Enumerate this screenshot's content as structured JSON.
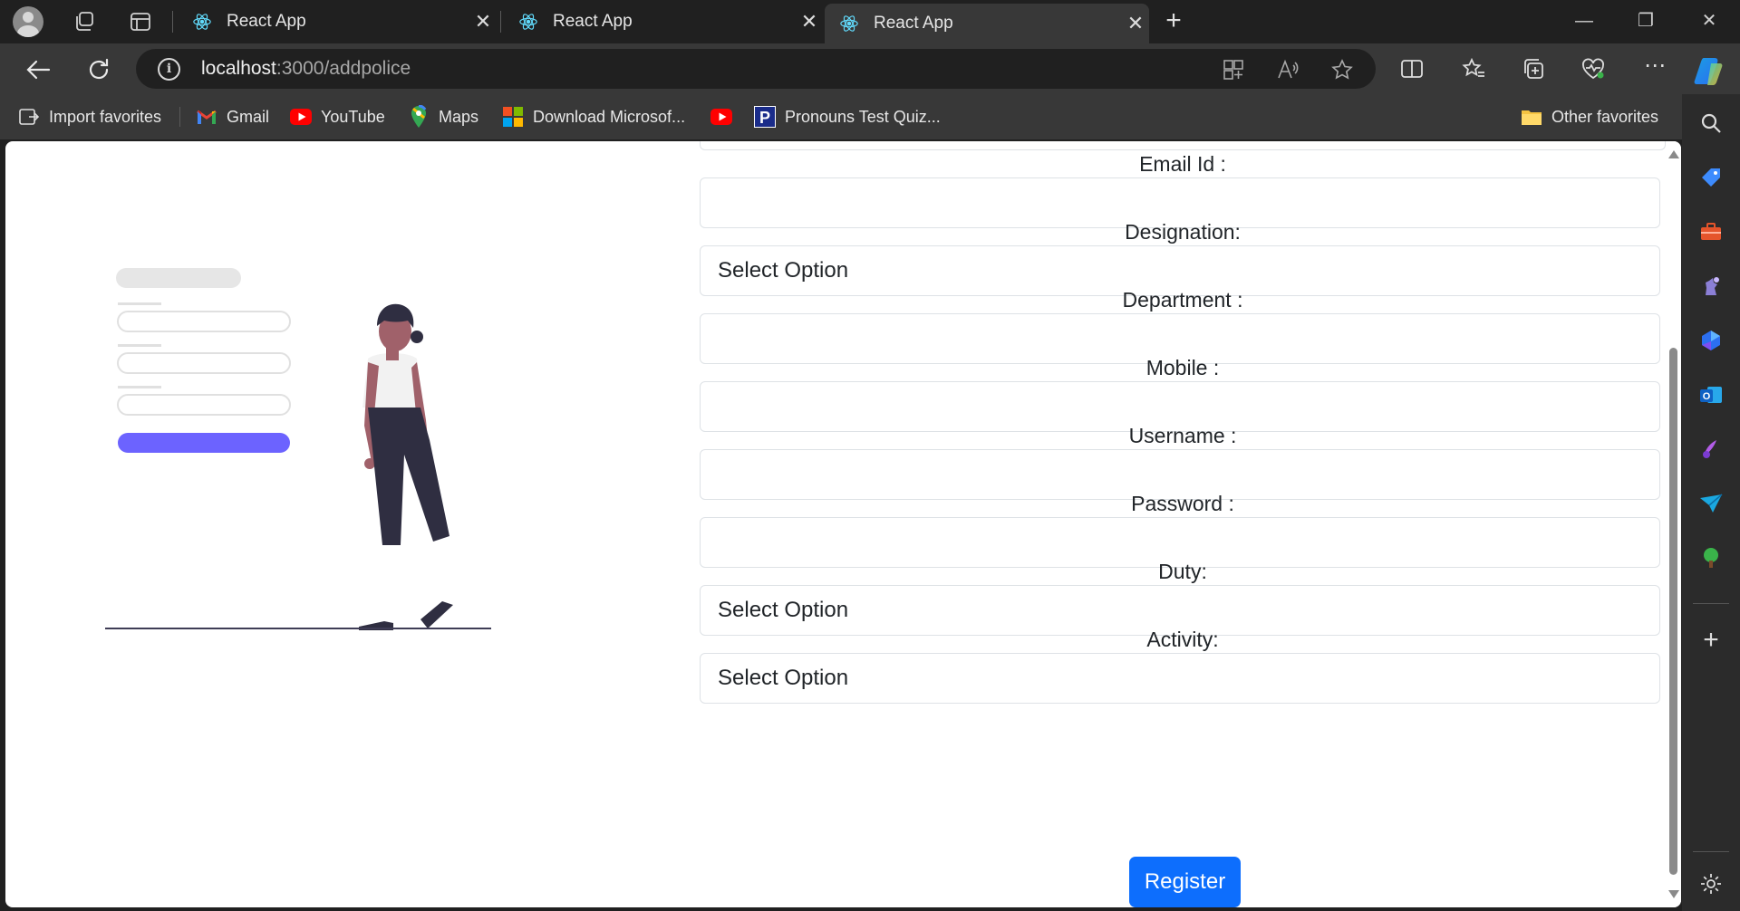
{
  "browser": {
    "tabs": [
      {
        "title": "React App",
        "active": false
      },
      {
        "title": "React App",
        "active": false
      },
      {
        "title": "React App",
        "active": true
      }
    ],
    "address": {
      "host": "localhost",
      "path": ":3000/addpolice"
    },
    "favorites": [
      {
        "label": "Import favorites",
        "icon": "import-icon"
      },
      {
        "label": "Gmail",
        "icon": "gmail-icon"
      },
      {
        "label": "YouTube",
        "icon": "youtube-icon"
      },
      {
        "label": "Maps",
        "icon": "maps-icon"
      },
      {
        "label": "Download Microsof...",
        "icon": "microsoft-icon"
      },
      {
        "label": "",
        "icon": "youtube-icon"
      },
      {
        "label": "Pronouns Test Quiz...",
        "icon": "pronouns-icon"
      }
    ],
    "other_favorites": "Other favorites"
  },
  "form": {
    "fields": [
      {
        "label": "Email Id :",
        "type": "input",
        "value": ""
      },
      {
        "label": "Designation:",
        "type": "select",
        "value": "Select Option"
      },
      {
        "label": "Department :",
        "type": "input",
        "value": ""
      },
      {
        "label": "Mobile :",
        "type": "input",
        "value": ""
      },
      {
        "label": "Username :",
        "type": "input",
        "value": ""
      },
      {
        "label": "Password :",
        "type": "input",
        "value": ""
      },
      {
        "label": "Duty:",
        "type": "select",
        "value": "Select Option"
      },
      {
        "label": "Activity:",
        "type": "select",
        "value": "Select Option"
      }
    ],
    "submit_label": "Register"
  },
  "colors": {
    "accent": "#0d6efd",
    "illustration_accent": "#6c63ff",
    "browser_dark": "#202020",
    "browser_toolbar": "#383838"
  }
}
